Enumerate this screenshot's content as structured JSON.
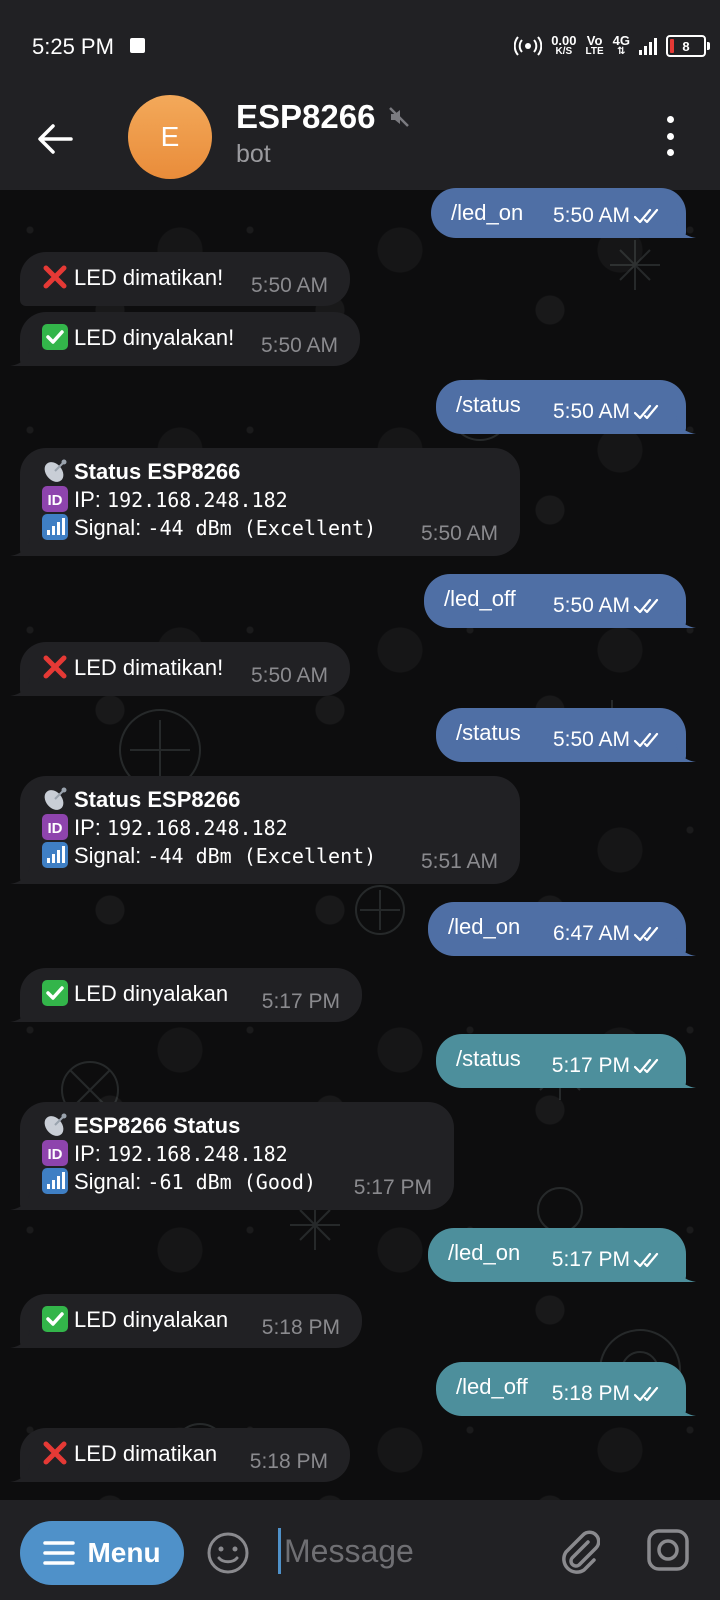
{
  "status_bar": {
    "time": "5:25 PM",
    "net_speed": "0.00",
    "net_unit": "K/S",
    "volte_top": "Vo",
    "volte_bottom": "LTE",
    "network_type": "4G",
    "battery": "8"
  },
  "header": {
    "avatar_letter": "E",
    "title": "ESP8266",
    "subtitle": "bot",
    "avatar_color": "#ec9a45"
  },
  "messages": [
    {
      "dir": "out",
      "text": "/led_on",
      "time": "5:50 AM"
    },
    {
      "dir": "in",
      "icon": "cross-mark-icon",
      "text": "LED dimatikan!",
      "time": "5:50 AM"
    },
    {
      "dir": "in",
      "icon": "check-mark-icon",
      "text": "LED dinyalakan!",
      "time": "5:50 AM"
    },
    {
      "dir": "out",
      "text": "/status",
      "time": "5:50 AM"
    },
    {
      "dir": "in",
      "title": "Status ESP8266",
      "ip_label": "IP:",
      "ip": "192.168.248.182",
      "signal_label": "Signal:",
      "signal": "-44 dBm (Excellent)",
      "time": "5:50 AM"
    },
    {
      "dir": "out",
      "text": "/led_off",
      "time": "5:50 AM"
    },
    {
      "dir": "in",
      "icon": "cross-mark-icon",
      "text": "LED dimatikan!",
      "time": "5:50 AM"
    },
    {
      "dir": "out",
      "text": "/status",
      "time": "5:50 AM"
    },
    {
      "dir": "in",
      "title": "Status ESP8266",
      "ip_label": "IP:",
      "ip": "192.168.248.182",
      "signal_label": "Signal:",
      "signal": "-44 dBm (Excellent)",
      "time": "5:51 AM"
    },
    {
      "dir": "out",
      "text": "/led_on",
      "time": "6:47 AM"
    },
    {
      "dir": "in",
      "icon": "check-mark-icon",
      "text": "LED dinyalakan",
      "time": "5:17 PM"
    },
    {
      "dir": "out",
      "text": "/status",
      "time": "5:17 PM"
    },
    {
      "dir": "in",
      "title": "ESP8266 Status",
      "ip_label": "IP:",
      "ip": "192.168.248.182",
      "signal_label": "Signal:",
      "signal": "-61 dBm (Good)",
      "time": "5:17 PM"
    },
    {
      "dir": "out",
      "text": "/led_on",
      "time": "5:17 PM"
    },
    {
      "dir": "in",
      "icon": "check-mark-icon",
      "text": "LED dinyalakan",
      "time": "5:18 PM"
    },
    {
      "dir": "out",
      "text": "/led_off",
      "time": "5:18 PM"
    },
    {
      "dir": "in",
      "icon": "cross-mark-icon",
      "text": "LED dimatikan",
      "time": "5:18 PM"
    }
  ],
  "input_bar": {
    "menu_label": "Menu",
    "placeholder": "Message"
  },
  "colors": {
    "outgoing": "#4f6fa5",
    "outgoing_late": "#4d8f9c",
    "incoming": "#212124",
    "accent": "#4f91c9"
  }
}
